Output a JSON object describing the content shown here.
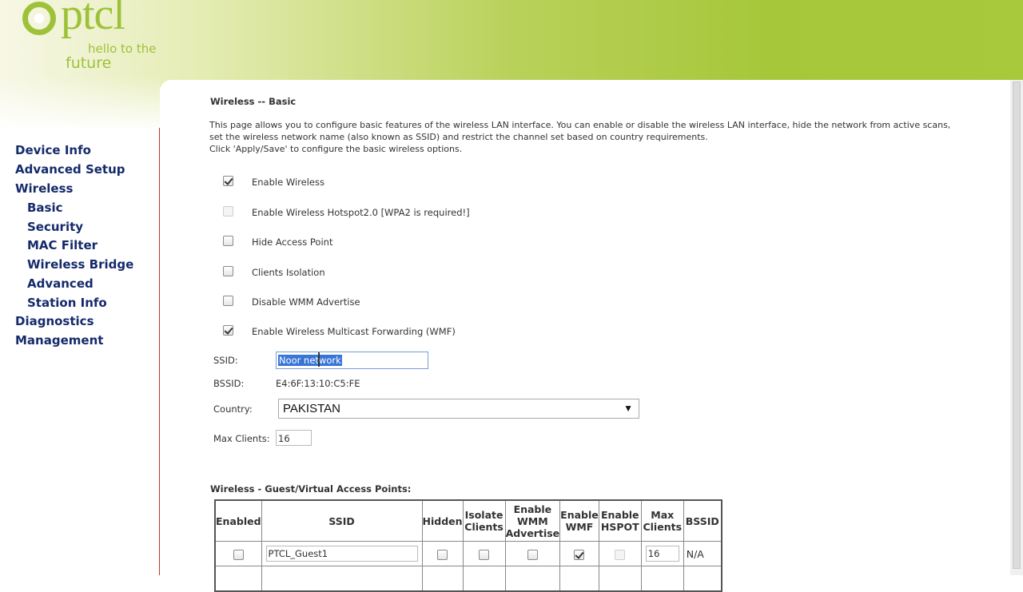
{
  "brand": {
    "name": "ptcl",
    "tagline_1": "hello to the",
    "tagline_2": "future",
    "color": "#9dc23a"
  },
  "nav": [
    {
      "label": "Device Info",
      "level": 0
    },
    {
      "label": "Advanced Setup",
      "level": 0
    },
    {
      "label": "Wireless",
      "level": 0
    },
    {
      "label": "Basic",
      "level": 1
    },
    {
      "label": "Security",
      "level": 1
    },
    {
      "label": "MAC Filter",
      "level": 1
    },
    {
      "label": "Wireless Bridge",
      "level": 1
    },
    {
      "label": "Advanced",
      "level": 1
    },
    {
      "label": "Station Info",
      "level": 1
    },
    {
      "label": "Diagnostics",
      "level": 0
    },
    {
      "label": "Management",
      "level": 0
    }
  ],
  "page": {
    "title": "Wireless -- Basic",
    "description_1": "This page allows you to configure basic features of the wireless LAN interface. You can enable or disable the wireless LAN interface, hide the network from active scans,",
    "description_2": "set the wireless network name (also known as SSID) and restrict the channel set based on country requirements.",
    "description_3": "Click 'Apply/Save' to configure the basic wireless options."
  },
  "options": [
    {
      "label": "Enable Wireless",
      "checked": true,
      "disabled": false
    },
    {
      "label": "Enable Wireless Hotspot2.0 [WPA2 is required!]",
      "checked": false,
      "disabled": true
    },
    {
      "label": "Hide Access Point",
      "checked": false,
      "disabled": false
    },
    {
      "label": "Clients Isolation",
      "checked": false,
      "disabled": false
    },
    {
      "label": "Disable WMM Advertise",
      "checked": false,
      "disabled": false
    },
    {
      "label": "Enable Wireless Multicast Forwarding (WMF)",
      "checked": true,
      "disabled": false
    }
  ],
  "fields": {
    "ssid_label": "SSID:",
    "ssid_value": "Noor network",
    "bssid_label": "BSSID:",
    "bssid_value": "E4:6F:13:10:C5:FE",
    "country_label": "Country:",
    "country_value": "PAKISTAN",
    "maxclients_label": "Max Clients:",
    "maxclients_value": "16"
  },
  "guest": {
    "title": "Wireless - Guest/Virtual Access Points:",
    "headers": [
      "Enabled",
      "SSID",
      "Hidden",
      "Isolate Clients",
      "Enable WMM Advertise",
      "Enable WMF",
      "Enable HSPOT",
      "Max Clients",
      "BSSID"
    ],
    "rows": [
      {
        "enabled": false,
        "ssid": "PTCL_Guest1",
        "hidden": false,
        "isolate": false,
        "wmm": false,
        "wmf": true,
        "hspot": false,
        "max": "16",
        "bssid": "N/A"
      }
    ]
  }
}
